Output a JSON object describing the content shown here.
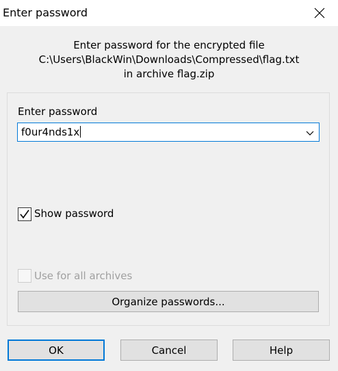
{
  "window": {
    "title": "Enter password",
    "close_icon": "close-icon"
  },
  "header": {
    "line1": "Enter password for the encrypted file",
    "line2": "C:\\Users\\BlackWin\\Downloads\\Compressed\\flag.txt",
    "line3": "in archive flag.zip"
  },
  "password": {
    "label": "Enter password",
    "value": "f0ur4nds1x",
    "dropdown_icon": "chevron-down-icon"
  },
  "show_password": {
    "label": "Show password",
    "checked": true
  },
  "use_for_all": {
    "label": "Use for all archives",
    "checked": false,
    "disabled": true
  },
  "organize_button": {
    "label": "Organize passwords..."
  },
  "buttons": {
    "ok": "OK",
    "cancel": "Cancel",
    "help": "Help"
  },
  "colors": {
    "accent": "#0078d7",
    "dialog_bg": "#f0f0f0",
    "button_bg": "#e1e1e1",
    "disabled_text": "#a0a0a0"
  }
}
